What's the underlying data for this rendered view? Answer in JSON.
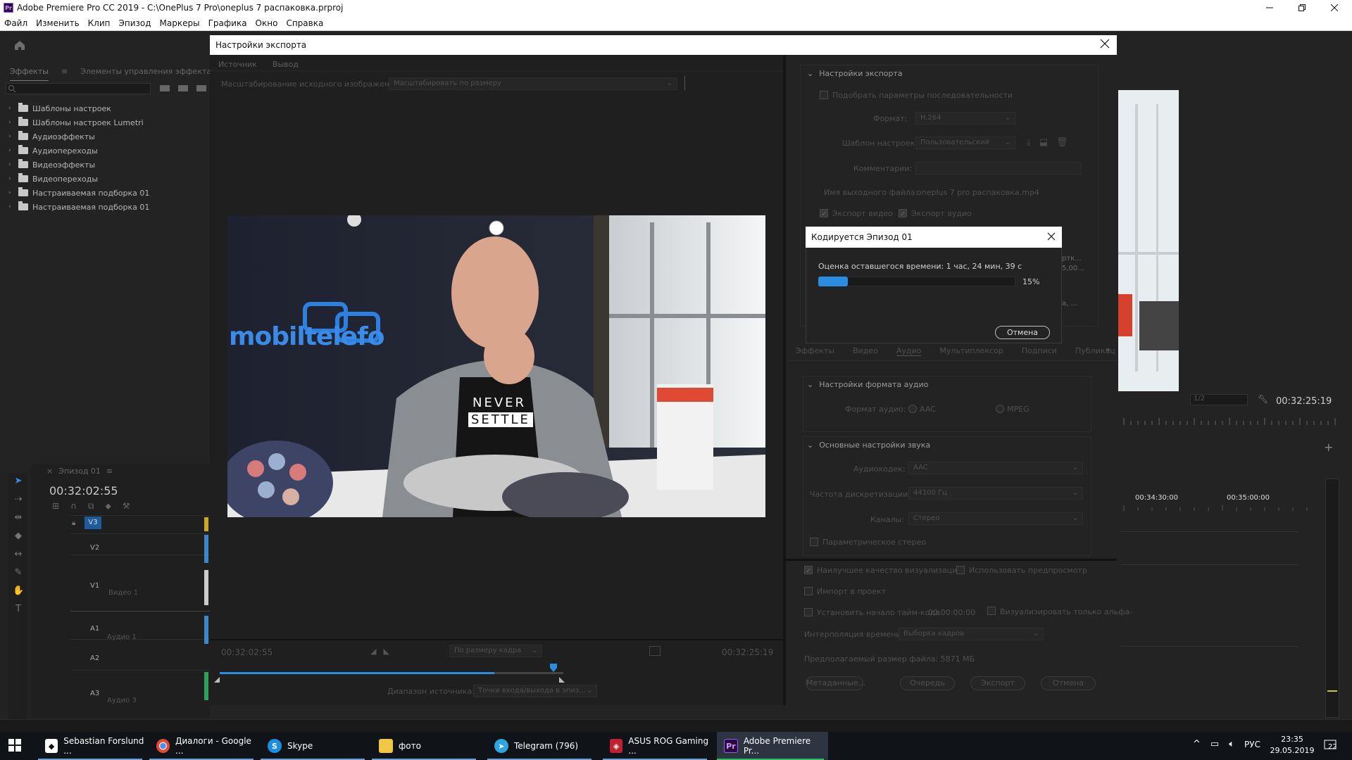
{
  "window": {
    "title": "Adobe Premiere Pro CC 2019 - C:\\OnePlus 7 Pro\\oneplus 7 распаковка.prproj",
    "logo_text": "Pr"
  },
  "menu": [
    "Файл",
    "Изменить",
    "Клип",
    "Эпизод",
    "Маркеры",
    "Графика",
    "Окно",
    "Справка"
  ],
  "effects_panel": {
    "tabs": [
      "Эффекты",
      "Элементы управления эффектами"
    ],
    "items": [
      "Шаблоны настроек",
      "Шаблоны настроек Lumetri",
      "Аудиоэффекты",
      "Аудиопереходы",
      "Видеоэффекты",
      "Видеопереходы",
      "Настраиваемая подборка 01",
      "Настраиваемая подборка 01"
    ]
  },
  "timeline": {
    "tab": "Эпизод 01",
    "timecode": "00:32:02:55",
    "tracks": [
      {
        "id": "V3",
        "name": ""
      },
      {
        "id": "V2",
        "name": ""
      },
      {
        "id": "V1",
        "name": "Видео 1"
      },
      {
        "id": "A1",
        "name": "Аудио 1"
      },
      {
        "id": "A2",
        "name": ""
      },
      {
        "id": "A3",
        "name": "Аудио 3"
      }
    ]
  },
  "program_monitor": {
    "timecode": "00:32:25:19",
    "zoom": "1/2",
    "ruler": [
      "00:34:30:00",
      "00:35:00:00"
    ]
  },
  "export_dialog": {
    "title": "Настройки экспорта",
    "tabs": [
      "Источник",
      "Вывод"
    ],
    "active_tab": "Вывод",
    "scale_label": "Масштабирование исходного изображения:",
    "scale_value": "Масштабировать по размеру",
    "video_overlay_text": "mobiltelefo",
    "shirt_line1": "NEVER",
    "shirt_line2": "SETTLE",
    "tc_in": "00:32:02:55",
    "tc_out": "00:32:25:19",
    "fit": "По размеру кадра",
    "source_range_label": "Диапазон источника:",
    "source_range_value": "Точки входа/выхода в эпиз...",
    "progress": 0.8,
    "settings": {
      "section_title": "Настройки экспорта",
      "match_seq": "Подобрать параметры последовательности",
      "format_label": "Формат:",
      "format_value": "H.264",
      "preset_label": "Шаблон настроек:",
      "preset_value": "Пользовательский",
      "comments_label": "Комментарии:",
      "output_label": "Имя выходного файла:",
      "output_value": "oneplus 7 pro распаковка.mp4",
      "export_video": "Экспорт видео",
      "export_audio": "Экспорт аудио",
      "summary_frag1": "ртк...",
      "summary_frag2": "5,00...",
      "summary_frag3": "а, ..."
    },
    "lower_tabs": [
      "Эффекты",
      "Видео",
      "Аудио",
      "Мультиплексор",
      "Подписи",
      "Публикац"
    ],
    "lower_tabs_more": "»",
    "audio_format": {
      "section": "Настройки формата аудио",
      "label": "Формат аудио:",
      "opt1": "AAC",
      "opt2": "MPEG"
    },
    "basic_audio": {
      "section": "Основные настройки звука",
      "codec_label": "Аудиокодек:",
      "codec_value": "AAC",
      "rate_label": "Частота дискретизации:",
      "rate_value": "44100 Гц",
      "channels_label": "Каналы:",
      "channels_value": "Стерео",
      "param_stereo": "Параметрическое стерео"
    },
    "bottom": {
      "max_quality": "Наилучшее качество визуализации",
      "use_previews": "Использовать предпросмотр",
      "import_project": "Импорт в проект",
      "set_start_tc": "Установить начало тайм-кода",
      "start_tc": "00:00:00:00",
      "render_alpha": "Визуализировать только альфа-",
      "time_interp_label": "Интерполяция времени:",
      "time_interp_value": "Выборка кадров",
      "file_size": "Предполагаемый размер файла:  5871 МБ",
      "btn_metadata": "Метаданные...",
      "btn_queue": "Очередь",
      "btn_export": "Экспорт",
      "btn_cancel": "Отмена"
    }
  },
  "encode_dialog": {
    "title": "Кодируется Эпизод 01",
    "estimate": "Оценка оставшегося времени: 1 час, 24 мин, 39 с",
    "percent_text": "15%",
    "progress": 0.15,
    "cancel": "Отмена"
  },
  "taskbar": {
    "items": [
      {
        "label": "Sebastian Forslund ...",
        "icon": "fox-icon"
      },
      {
        "label": "Диалоги - Google ...",
        "icon": "chrome-icon"
      },
      {
        "label": "Skype",
        "icon": "skype-icon"
      },
      {
        "label": "фото",
        "icon": "folder-icon"
      },
      {
        "label": "Telegram (796)",
        "icon": "telegram-icon"
      },
      {
        "label": "ASUS ROG Gaming ...",
        "icon": "asus-rog-icon"
      },
      {
        "label": "Adobe Premiere Pr...",
        "icon": "premiere-icon"
      }
    ],
    "lang": "РУС",
    "time": "23:35",
    "date": "29.05.2019",
    "notif_count": "22"
  }
}
